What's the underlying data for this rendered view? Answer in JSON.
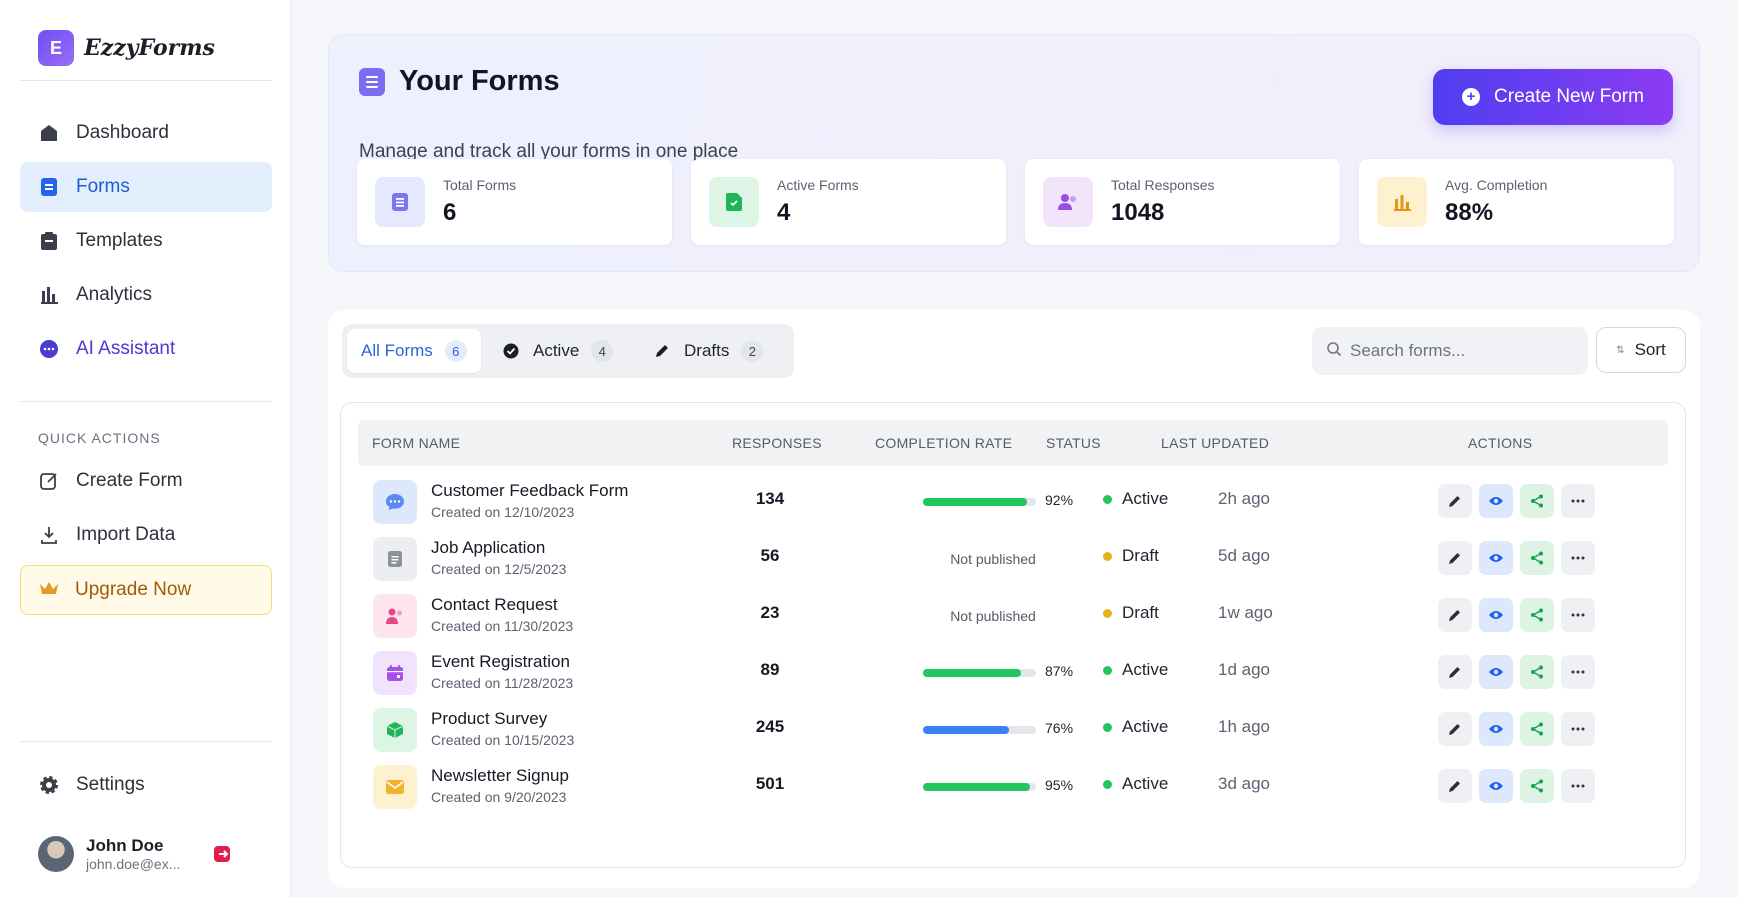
{
  "brand": {
    "logo_letter": "E",
    "name": "EzzyForms"
  },
  "sidebar": {
    "nav": [
      {
        "label": "Dashboard",
        "icon": "home-icon"
      },
      {
        "label": "Forms",
        "icon": "document-icon",
        "active": true
      },
      {
        "label": "Templates",
        "icon": "clipboard-icon"
      },
      {
        "label": "Analytics",
        "icon": "bar-chart-icon"
      },
      {
        "label": "AI Assistant",
        "icon": "chat-bubble-icon"
      }
    ],
    "quick_actions_label": "QUICK ACTIONS",
    "quick_actions": [
      {
        "label": "Create Form",
        "icon": "edit-square-icon"
      },
      {
        "label": "Import Data",
        "icon": "download-icon"
      }
    ],
    "upgrade_label": "Upgrade Now",
    "settings_label": "Settings",
    "user": {
      "name": "John Doe",
      "email": "john.doe@ex..."
    }
  },
  "header": {
    "title": "Your Forms",
    "subtitle": "Manage and track all your forms in one place",
    "create_button": "Create New Form",
    "stats": [
      {
        "label": "Total Forms",
        "value": "6",
        "color": "#6d6af2",
        "bg": "#e6e9fd"
      },
      {
        "label": "Active Forms",
        "value": "4",
        "color": "#22b45a",
        "bg": "#dcf5e4"
      },
      {
        "label": "Total Responses",
        "value": "1048",
        "color": "#9a4ee3",
        "bg": "#f1e4fb"
      },
      {
        "label": "Avg. Completion",
        "value": "88%",
        "color": "#e2951b",
        "bg": "#fdf1cf"
      }
    ]
  },
  "tabs": [
    {
      "label": "All Forms",
      "count": "6",
      "active": true
    },
    {
      "label": "Active",
      "count": "4"
    },
    {
      "label": "Drafts",
      "count": "2"
    }
  ],
  "search": {
    "placeholder": "Search forms..."
  },
  "sort_label": "Sort",
  "table": {
    "columns": [
      "FORM NAME",
      "RESPONSES",
      "COMPLETION RATE",
      "STATUS",
      "LAST UPDATED",
      "ACTIONS"
    ],
    "rows": [
      {
        "name": "Customer Feedback Form",
        "created": "Created on 12/10/2023",
        "responses": "134",
        "completion": 92,
        "completion_label": "92%",
        "status": "Active",
        "updated": "2h ago",
        "icon": "chat-icon",
        "icon_color": "#5b8af0",
        "icon_bg": "#dde8fc",
        "bar_color": "#22c55e"
      },
      {
        "name": "Job Application",
        "created": "Created on 12/5/2023",
        "responses": "56",
        "completion": null,
        "completion_label": "Not published",
        "status": "Draft",
        "updated": "5d ago",
        "icon": "document-icon",
        "icon_color": "#8a909c",
        "icon_bg": "#eceef1",
        "bar_color": "#22c55e"
      },
      {
        "name": "Contact Request",
        "created": "Created on 11/30/2023",
        "responses": "23",
        "completion": null,
        "completion_label": "Not published",
        "status": "Draft",
        "updated": "1w ago",
        "icon": "users-icon",
        "icon_color": "#e4478a",
        "icon_bg": "#fde4ef",
        "bar_color": "#22c55e"
      },
      {
        "name": "Event Registration",
        "created": "Created on 11/28/2023",
        "responses": "89",
        "completion": 87,
        "completion_label": "87%",
        "status": "Active",
        "updated": "1d ago",
        "icon": "calendar-icon",
        "icon_color": "#a452ea",
        "icon_bg": "#f2e3fc",
        "bar_color": "#22c55e"
      },
      {
        "name": "Product Survey",
        "created": "Created on 10/15/2023",
        "responses": "245",
        "completion": 76,
        "completion_label": "76%",
        "status": "Active",
        "updated": "1h ago",
        "icon": "cube-icon",
        "icon_color": "#22b45a",
        "icon_bg": "#dcf5e4",
        "bar_color": "#3b82f6"
      },
      {
        "name": "Newsletter Signup",
        "created": "Created on 9/20/2023",
        "responses": "501",
        "completion": 95,
        "completion_label": "95%",
        "status": "Active",
        "updated": "3d ago",
        "icon": "mail-icon",
        "icon_color": "#f2b22c",
        "icon_bg": "#fdf1cf",
        "bar_color": "#22c55e"
      }
    ]
  },
  "status_colors": {
    "Active": "#22c55e",
    "Draft": "#e8b21c"
  }
}
